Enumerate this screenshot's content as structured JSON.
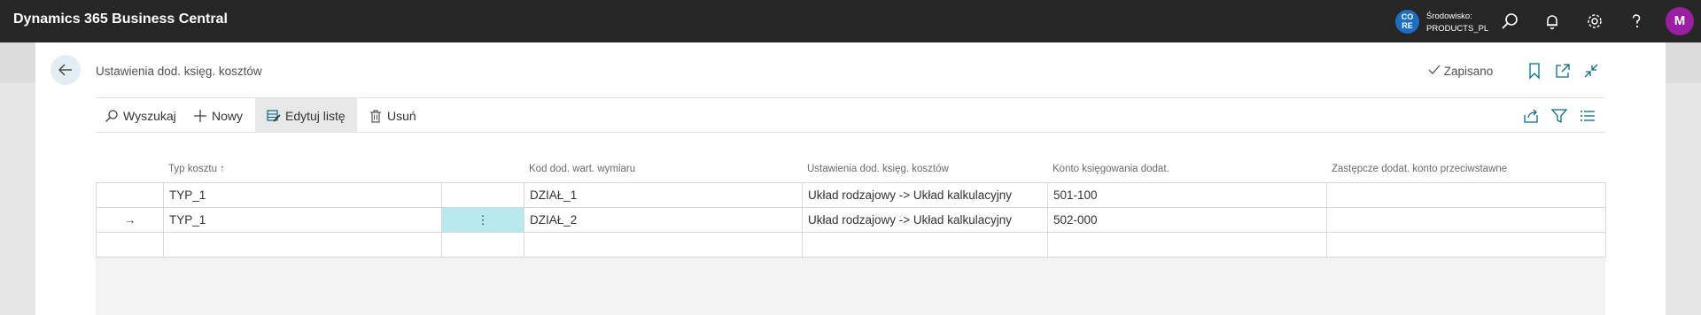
{
  "app": {
    "title": "Dynamics 365 Business Central"
  },
  "topbar": {
    "env_badge": [
      "CO",
      "RE"
    ],
    "env_label_line1": "Środowisko:",
    "env_label_line2": "PRODUCTS_PL",
    "icons": [
      "search-icon",
      "bell-icon",
      "gear-icon",
      "help-icon"
    ],
    "avatar_initial": "M",
    "avatar_color": "#9b1fa3"
  },
  "page": {
    "title": "Ustawienia dod. księg. kosztów",
    "saved_label": "Zapisano"
  },
  "actions": {
    "search": "Wyszukaj",
    "new": "Nowy",
    "edit_list": "Edytuj listę",
    "delete": "Usuń"
  },
  "grid": {
    "columns": [
      "Typ kosztu ↑",
      "Kod dod. wart. wymiaru",
      "Ustawienia dod. księg. kosztów",
      "Konto księgowania dodat.",
      "Zastępcze dodat. konto przeciwstawne"
    ],
    "rows": [
      {
        "marker": "",
        "typ": "TYP_1",
        "kod": "DZIAŁ_1",
        "ustawienia": "Układ rodzajowy -> Układ kalkulacyjny",
        "konto": "501-100",
        "zastepcze": ""
      },
      {
        "marker": "→",
        "typ": "TYP_1",
        "kod": "DZIAŁ_2",
        "ustawienia": "Układ rodzajowy -> Układ kalkulacyjny",
        "konto": "502-000",
        "zastepcze": ""
      },
      {
        "marker": "",
        "typ": "",
        "kod": "",
        "ustawienia": "",
        "konto": "",
        "zastepcze": ""
      }
    ],
    "row_menu_glyph": "⋮",
    "selected_color": "#b8e9ee"
  }
}
